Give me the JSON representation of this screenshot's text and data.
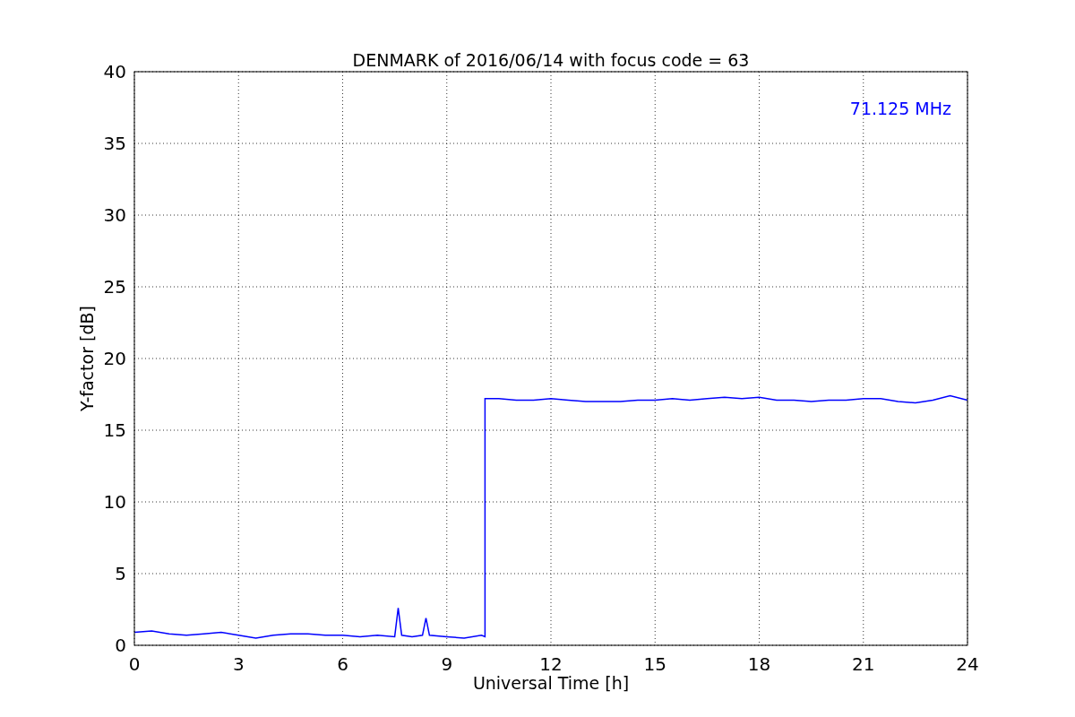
{
  "chart_data": {
    "type": "line",
    "title": "DENMARK of 2016/06/14 with focus code = 63",
    "xlabel": "Universal Time [h]",
    "ylabel": "Y-factor [dB]",
    "x": [
      0,
      0.5,
      1,
      1.5,
      2,
      2.5,
      3,
      3.5,
      4,
      4.5,
      5,
      5.5,
      6,
      6.5,
      7,
      7.5,
      7.6,
      7.7,
      8,
      8.3,
      8.4,
      8.5,
      9,
      9.5,
      10,
      10.1,
      10.1,
      10.5,
      11,
      11.5,
      12,
      12.5,
      13,
      13.5,
      14,
      14.5,
      15,
      15.5,
      16,
      16.5,
      17,
      17.5,
      18,
      18.5,
      19,
      19.5,
      20,
      20.5,
      21,
      21.5,
      22,
      22.5,
      23,
      23.5,
      24
    ],
    "series": [
      {
        "name": "71.125 MHz",
        "color": "#0000ff",
        "values": [
          0.9,
          1.0,
          0.8,
          0.7,
          0.8,
          0.9,
          0.7,
          0.5,
          0.7,
          0.8,
          0.8,
          0.7,
          0.7,
          0.6,
          0.7,
          0.6,
          2.6,
          0.7,
          0.6,
          0.7,
          1.9,
          0.7,
          0.6,
          0.5,
          0.7,
          0.6,
          17.2,
          17.2,
          17.1,
          17.1,
          17.2,
          17.1,
          17.0,
          17.0,
          17.0,
          17.1,
          17.1,
          17.2,
          17.1,
          17.2,
          17.3,
          17.2,
          17.3,
          17.1,
          17.1,
          17.0,
          17.1,
          17.1,
          17.2,
          17.2,
          17.0,
          16.9,
          17.1,
          17.4,
          17.1
        ]
      }
    ],
    "xlim": [
      0,
      24
    ],
    "ylim": [
      0,
      40
    ],
    "xticks": [
      0,
      3,
      6,
      9,
      12,
      15,
      18,
      21,
      24
    ],
    "yticks": [
      0,
      5,
      10,
      15,
      20,
      25,
      30,
      35,
      40
    ],
    "grid": true
  }
}
